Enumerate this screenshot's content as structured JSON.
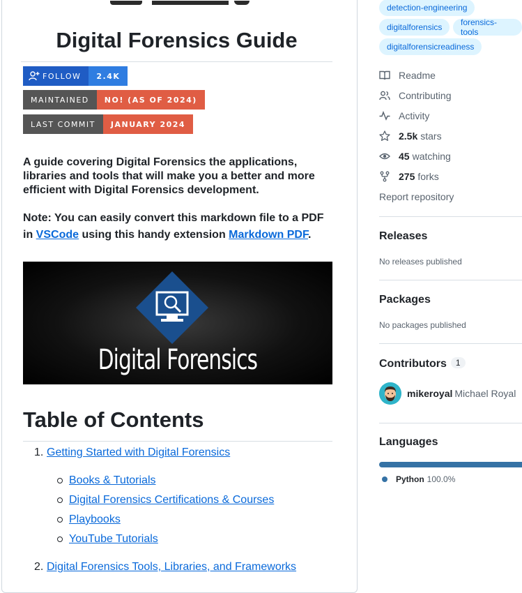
{
  "readme": {
    "title": "Digital Forensics Guide",
    "badges": {
      "follow_label": "FOLLOW",
      "follow_value": "2.4K",
      "maintained_label": "MAINTAINED",
      "maintained_value": "NO! (AS OF 2024)",
      "commit_label": "LAST COMMIT",
      "commit_value": "JANUARY 2024"
    },
    "description": "A guide covering Digital Forensics the applications, libraries and tools that will make you a better and more efficient with Digital Forensics development.",
    "note_prefix": "Note: You can easily convert this markdown file to a PDF in ",
    "note_link1": "VSCode",
    "note_middle": " using this handy extension ",
    "note_link2": "Markdown PDF",
    "note_suffix": ".",
    "banner_text": "Digital Forensics",
    "toc_heading": "Table of Contents",
    "toc": [
      {
        "num": "1.",
        "label": "Getting Started with Digital Forensics",
        "children": [
          "Books & Tutorials",
          "Digital Forensics Certifications & Courses",
          "Playbooks",
          "YouTube Tutorials"
        ]
      },
      {
        "num": "2.",
        "label": "Digital Forensics Tools, Libraries, and Frameworks"
      }
    ]
  },
  "sidebar": {
    "topics": [
      "detection-engineering",
      "digitalforensics",
      "forensics-tools",
      "digitalforensicreadiness"
    ],
    "links": {
      "readme": "Readme",
      "contributing": "Contributing",
      "activity": "Activity",
      "stars_count": "2.5k",
      "stars_label": "stars",
      "watching_count": "45",
      "watching_label": "watching",
      "forks_count": "275",
      "forks_label": "forks",
      "report": "Report repository"
    },
    "releases": {
      "heading": "Releases",
      "note": "No releases published"
    },
    "packages": {
      "heading": "Packages",
      "note": "No packages published"
    },
    "contributors": {
      "heading": "Contributors",
      "count": "1",
      "login": "mikeroyal",
      "name": "Michael Royal"
    },
    "languages": {
      "heading": "Languages",
      "items": [
        {
          "name": "Python",
          "percent": "100.0%",
          "fraction": 1.0,
          "color": "#3572A5"
        }
      ]
    }
  },
  "colors": {
    "link": "#0969da",
    "badge_red": "#e05d44",
    "badge_gray": "#555555",
    "follow_blue": "#2f7de1",
    "python": "#3572A5"
  }
}
